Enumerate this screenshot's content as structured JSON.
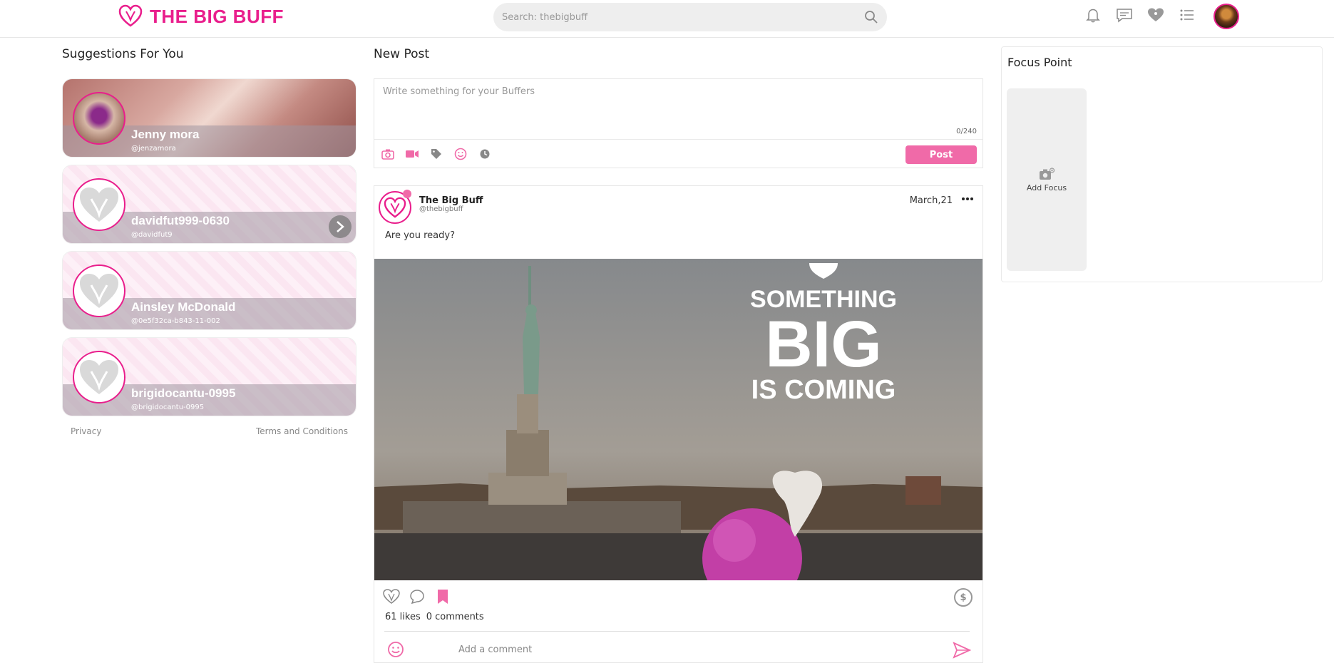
{
  "brand": {
    "name": "THE BIG BUFF",
    "accent_color": "#e91e8c",
    "button_color": "#f06aa8"
  },
  "search": {
    "placeholder": "Search: thebigbuff"
  },
  "top_icons": [
    "bell-icon",
    "chat-icon",
    "heart-broadcast-icon",
    "list-icon"
  ],
  "suggestions": {
    "title": "Suggestions For You",
    "items": [
      {
        "name": "Jenny mora",
        "handle": "@jenzamora"
      },
      {
        "name": "davidfut999-0630",
        "handle": "@davidfut9"
      },
      {
        "name": "Ainsley McDonald",
        "handle": "@0e5f32ca-b843-11-002"
      },
      {
        "name": "brigidocantu-0995",
        "handle": "@brigidocantu-0995"
      }
    ],
    "links": {
      "privacy": "Privacy",
      "terms": "Terms and Conditions"
    }
  },
  "new_post": {
    "title": "New Post",
    "placeholder": "Write something for your Buffers",
    "counter": "0/240",
    "tools": [
      "camera-icon",
      "video-icon",
      "tag-icon",
      "emoji-icon",
      "clock-icon"
    ],
    "button": "Post"
  },
  "post": {
    "author": "The Big Buff",
    "handle": "@thebigbuff",
    "date": "March,21",
    "text": "Are you ready?",
    "image_text": {
      "line1": "SOMETHING",
      "line2": "BIG",
      "line3": "IS COMING"
    },
    "likes": "61 likes",
    "comments": "0 comments",
    "comment_placeholder": "Add a comment"
  },
  "focus": {
    "title": "Focus Point",
    "add_label": "Add Focus"
  }
}
